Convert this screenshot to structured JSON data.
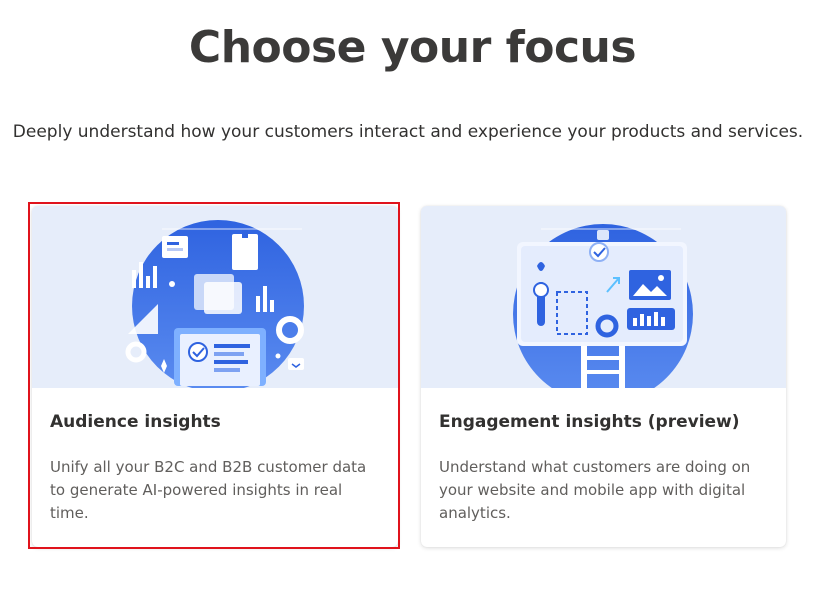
{
  "page": {
    "title": "Choose your focus",
    "subtitle": "Deeply understand how your customers interact and experience your products and services."
  },
  "cards": [
    {
      "title": "Audience insights",
      "description": "Unify all your B2C and B2B customer data to generate AI-powered insights in real time.",
      "selected": true,
      "illustration": "audience-insights-illustration"
    },
    {
      "title": "Engagement insights (preview)",
      "description": "Understand what customers are doing on your website and mobile app with digital analytics.",
      "selected": false,
      "illustration": "engagement-insights-illustration"
    }
  ],
  "colors": {
    "selection_outline": "#e0131c",
    "hero_background": "#e6edfa",
    "illustration_blue": "#3d6fe0"
  }
}
